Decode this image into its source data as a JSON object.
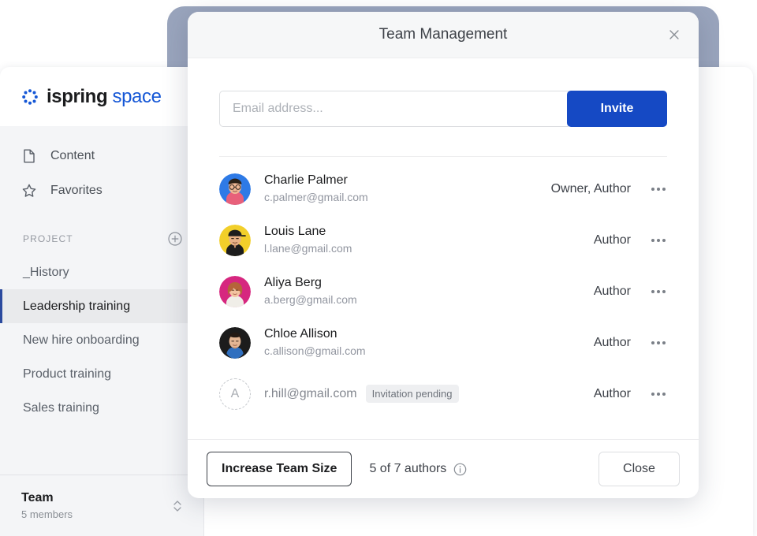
{
  "app": {
    "logo": {
      "brand": "ispring",
      "product": "space",
      "icon": "asterisk-icon",
      "brand_color": "#1b1c1e",
      "product_color": "#1557d6"
    },
    "nav": [
      {
        "label": "Content",
        "icon": "file-icon"
      },
      {
        "label": "Favorites",
        "icon": "star-icon"
      }
    ],
    "project_section": {
      "title": "PROJECT",
      "add_icon": "plus-circle-icon"
    },
    "projects": [
      {
        "label": "_History",
        "active": false
      },
      {
        "label": "Leadership training",
        "active": true
      },
      {
        "label": "New hire onboarding",
        "active": false
      },
      {
        "label": "Product training",
        "active": false
      },
      {
        "label": "Sales training",
        "active": false
      }
    ],
    "team": {
      "name": "Team",
      "members": "5 members",
      "icon": "up-down-chevron-icon"
    }
  },
  "modal": {
    "title": "Team Management",
    "close_icon": "close-icon",
    "invite": {
      "placeholder": "Email address...",
      "value": "",
      "button_label": "Invite",
      "button_color": "#1549c4"
    },
    "members": [
      {
        "name": "Charlie Palmer",
        "email": "c.palmer@gmail.com",
        "role": "Owner, Author",
        "avatar_color": "#2e7ae6",
        "pending": false,
        "badge": ""
      },
      {
        "name": "Louis Lane",
        "email": "l.lane@gmail.com",
        "role": "Author",
        "avatar_color": "#f2cf2a",
        "pending": false,
        "badge": ""
      },
      {
        "name": "Aliya Berg",
        "email": "a.berg@gmail.com",
        "role": "Author",
        "avatar_color": "#d6277f",
        "pending": false,
        "badge": ""
      },
      {
        "name": "Chloe Allison",
        "email": "c.allison@gmail.com",
        "role": "Author",
        "avatar_color": "#1c1c1c",
        "pending": false,
        "badge": ""
      },
      {
        "name": "",
        "email": "r.hill@gmail.com",
        "role": "Author",
        "avatar_color": "#ffffff",
        "pending": true,
        "badge": "Invitation pending",
        "avatar_initial": "A"
      }
    ],
    "footer": {
      "increase_label": "Increase Team Size",
      "authors_count": "5 of 7 authors",
      "info_icon": "info-circle-icon",
      "close_label": "Close"
    }
  }
}
